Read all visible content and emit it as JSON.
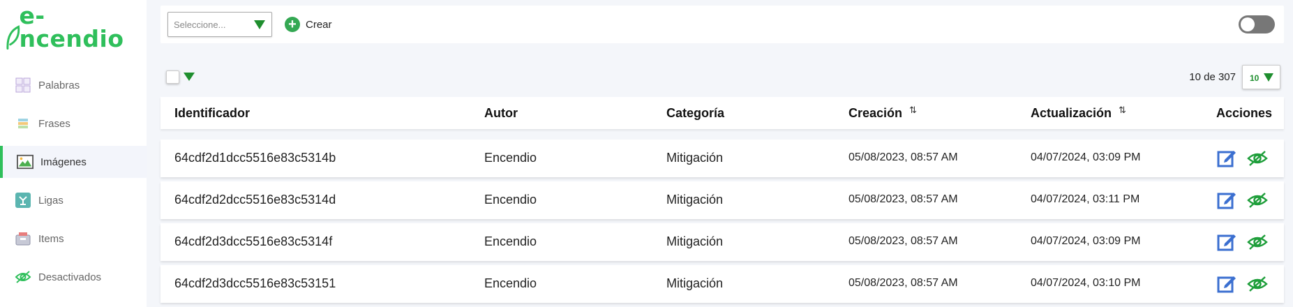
{
  "app": {
    "logo_text": "e-ncendio"
  },
  "sidebar": {
    "items": [
      {
        "label": "Palabras",
        "icon": "word-grid-icon"
      },
      {
        "label": "Frases",
        "icon": "phrases-icon"
      },
      {
        "label": "Imágenes",
        "icon": "image-icon",
        "active": true
      },
      {
        "label": "Ligas",
        "icon": "ligas-icon"
      },
      {
        "label": "Items",
        "icon": "items-icon"
      },
      {
        "label": "Desactivados",
        "icon": "eye-slash-icon"
      }
    ]
  },
  "toolbar": {
    "select_placeholder": "Seleccione...",
    "create_label": "Crear",
    "toggle_on": false
  },
  "pagination": {
    "summary": "10 de 307",
    "page_size": "10"
  },
  "table": {
    "headers": {
      "id": "Identificador",
      "author": "Autor",
      "category": "Categoría",
      "created": "Creación",
      "updated": "Actualización",
      "actions": "Acciones"
    },
    "rows": [
      {
        "id": "64cdf2d1dcc5516e83c5314b",
        "author": "Encendio",
        "category": "Mitigación",
        "created": "05/08/2023, 08:57 AM",
        "updated": "04/07/2024, 03:09 PM"
      },
      {
        "id": "64cdf2d2dcc5516e83c5314d",
        "author": "Encendio",
        "category": "Mitigación",
        "created": "05/08/2023, 08:57 AM",
        "updated": "04/07/2024, 03:11 PM"
      },
      {
        "id": "64cdf2d3dcc5516e83c5314f",
        "author": "Encendio",
        "category": "Mitigación",
        "created": "05/08/2023, 08:57 AM",
        "updated": "04/07/2024, 03:09 PM"
      },
      {
        "id": "64cdf2d3dcc5516e83c53151",
        "author": "Encendio",
        "category": "Mitigación",
        "created": "05/08/2023, 08:57 AM",
        "updated": "04/07/2024, 03:10 PM"
      }
    ]
  },
  "colors": {
    "brand_green": "#2fbf5b",
    "dark_green": "#1e8e2e",
    "edit_blue": "#3b6fd0"
  }
}
